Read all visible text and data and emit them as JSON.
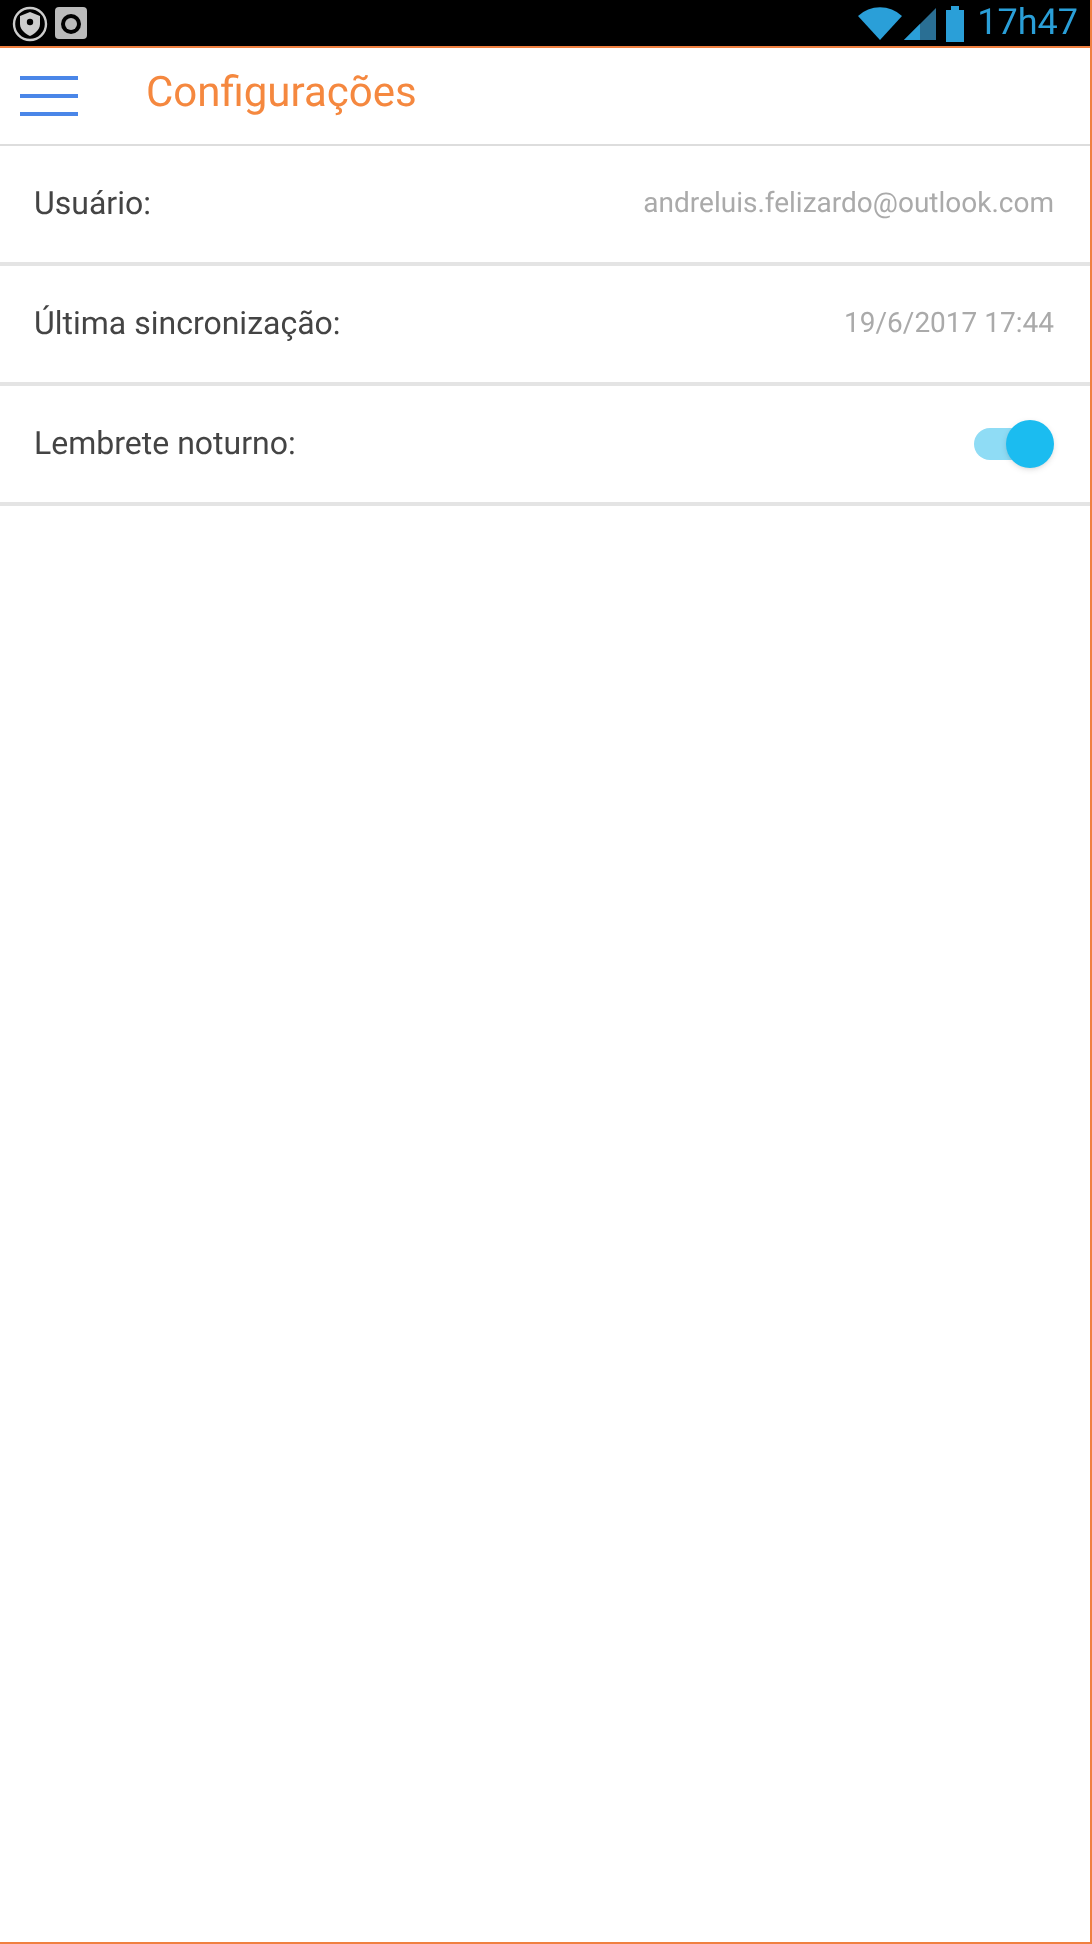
{
  "status_bar": {
    "time": "17h47"
  },
  "header": {
    "title": "Configurações"
  },
  "settings": [
    {
      "kind": "value",
      "label": "Usuário:",
      "value": "andreluis.felizardo@outlook.com"
    },
    {
      "kind": "value",
      "label": "Última sincronização:",
      "value": "19/6/2017 17:44"
    },
    {
      "kind": "toggle",
      "label": "Lembrete noturno:",
      "on": true
    }
  ]
}
